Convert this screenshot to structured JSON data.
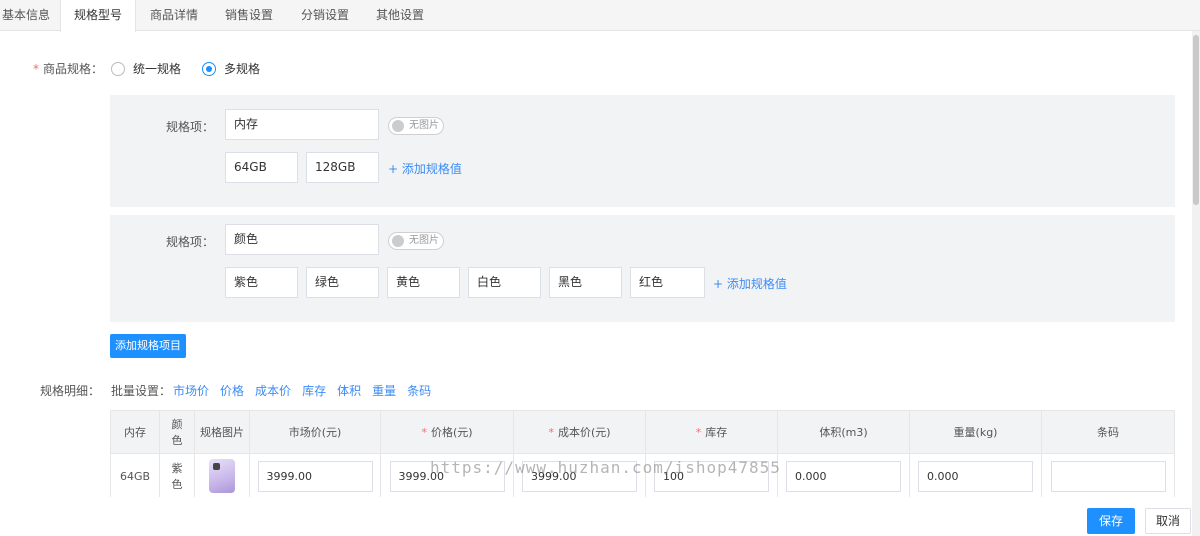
{
  "tabs": [
    {
      "label": "基本信息"
    },
    {
      "label": "规格型号"
    },
    {
      "label": "商品详情"
    },
    {
      "label": "销售设置"
    },
    {
      "label": "分销设置"
    },
    {
      "label": "其他设置"
    }
  ],
  "spec_type": {
    "label": "商品规格：",
    "options": [
      {
        "label": "统一规格"
      },
      {
        "label": "多规格"
      }
    ],
    "selected": "多规格"
  },
  "spec_items": [
    {
      "label": "规格项：",
      "name": "内存",
      "toggle": "无图片",
      "values": [
        "64GB",
        "128GB"
      ],
      "add_label": "+ 添加规格值"
    },
    {
      "label": "规格项：",
      "name": "颜色",
      "toggle": "无图片",
      "values": [
        "紫色",
        "绿色",
        "黄色",
        "白色",
        "黑色",
        "红色"
      ],
      "add_label": "+ 添加规格值"
    }
  ],
  "add_spec_item_button": "添加规格项目",
  "spec_detail": {
    "label": "规格明细：",
    "batch_label": "批量设置：",
    "batch_links": [
      "市场价",
      "价格",
      "成本价",
      "库存",
      "体积",
      "重量",
      "条码"
    ]
  },
  "table": {
    "headers": [
      "内存",
      "颜色",
      "规格图片",
      "市场价(元)",
      "价格(元)",
      "成本价(元)",
      "库存",
      "体积(m3)",
      "重量(kg)",
      "条码"
    ],
    "required_headers": [
      4,
      5,
      6
    ],
    "rows": [
      {
        "memory": "64GB",
        "color": "紫色",
        "market_price": "3999.00",
        "price": "3999.00",
        "cost": "3999.00",
        "stock": "100",
        "volume": "0.000",
        "weight": "0.000",
        "barcode": ""
      }
    ]
  },
  "watermark": "https://www.huzhan.com/ishop47855",
  "footer": {
    "save": "保存",
    "cancel": "取消"
  },
  "colors": {
    "accent": "#1e90ff",
    "link": "#3b8cf5",
    "required": "#f56c6c"
  }
}
